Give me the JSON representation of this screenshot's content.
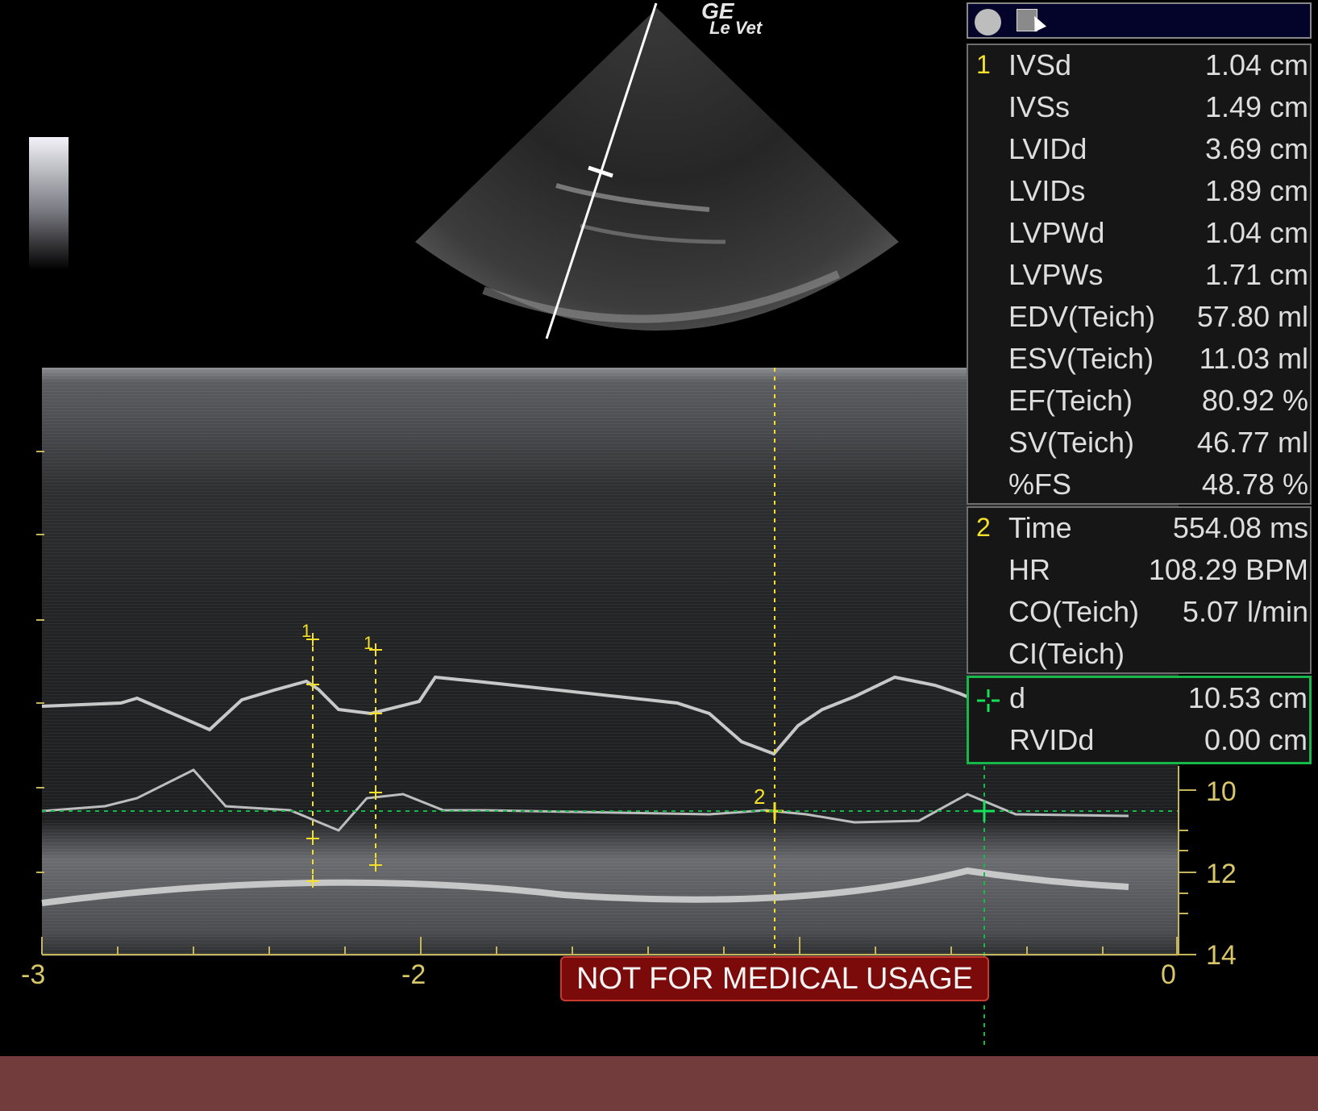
{
  "brand": {
    "line1": "GE",
    "line2": "Le Vet"
  },
  "warning": "NOT FOR MEDICAL USAGE",
  "x_axis": {
    "ticks": [
      "-3",
      "-2",
      "0"
    ]
  },
  "depth_axis": {
    "ticks": [
      "10",
      "12",
      "14"
    ]
  },
  "markers": {
    "m1a": "1",
    "m1b": "1",
    "m2": "2"
  },
  "toolbar": {
    "record_icon": "record-icon",
    "screen_icon": "screen-capture-icon"
  },
  "measurements": {
    "group1": {
      "index": "1",
      "rows": [
        {
          "label": "IVSd",
          "value": "1.04 cm"
        },
        {
          "label": "IVSs",
          "value": "1.49 cm"
        },
        {
          "label": "LVIDd",
          "value": "3.69 cm"
        },
        {
          "label": "LVIDs",
          "value": "1.89 cm"
        },
        {
          "label": "LVPWd",
          "value": "1.04 cm"
        },
        {
          "label": "LVPWs",
          "value": "1.71 cm"
        },
        {
          "label": "EDV(Teich)",
          "value": "57.80 ml"
        },
        {
          "label": "ESV(Teich)",
          "value": "11.03 ml"
        },
        {
          "label": "EF(Teich)",
          "value": "80.92 %"
        },
        {
          "label": "SV(Teich)",
          "value": "46.77 ml"
        },
        {
          "label": "%FS",
          "value": "48.78 %"
        }
      ]
    },
    "group2": {
      "index": "2",
      "rows": [
        {
          "label": "Time",
          "value": "554.08 ms"
        },
        {
          "label": "HR",
          "value": "108.29 BPM"
        },
        {
          "label": "CO(Teich)",
          "value": "5.07 l/min"
        },
        {
          "label": "CI(Teich)",
          "value": ""
        }
      ]
    },
    "group3": {
      "icon": "crosshair-icon",
      "rows": [
        {
          "label": "d",
          "value": "10.53 cm"
        },
        {
          "label": "RVIDd",
          "value": "0.00 cm"
        }
      ]
    }
  },
  "colors": {
    "caliper": "#f4e02a",
    "active_cursor": "#16b84a",
    "warning_bg": "#7b0a0a",
    "footer": "#733c3c"
  }
}
